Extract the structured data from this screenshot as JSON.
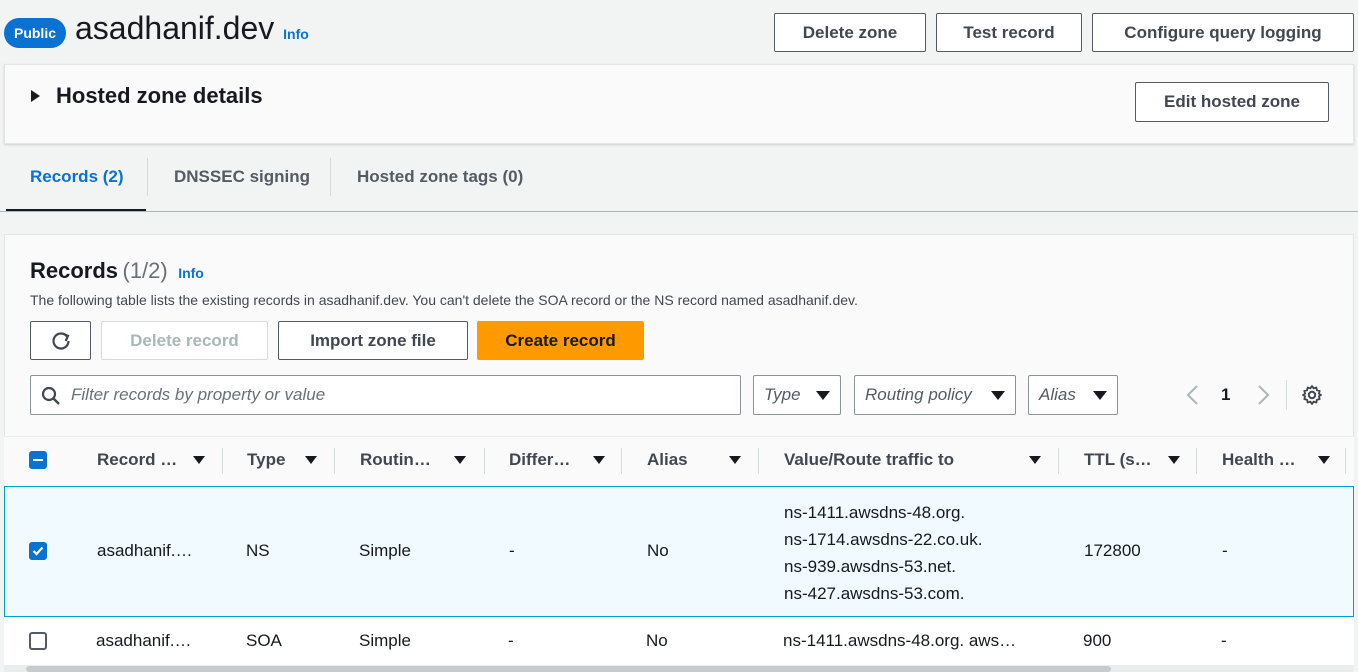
{
  "header": {
    "badge": "Public",
    "zone_name": "asadhanif.dev",
    "info": "Info",
    "buttons": {
      "delete_zone": "Delete zone",
      "test_record": "Test record",
      "configure_logging": "Configure query logging"
    }
  },
  "details_panel": {
    "title": "Hosted zone details",
    "edit_button": "Edit hosted zone"
  },
  "tabs": [
    {
      "label": "Records (2)",
      "active": true
    },
    {
      "label": "DNSSEC signing",
      "active": false
    },
    {
      "label": "Hosted zone tags (0)",
      "active": false
    }
  ],
  "records": {
    "title": "Records",
    "count": "(1/2)",
    "info": "Info",
    "description": "The following table lists the existing records in asadhanif.dev. You can't delete the SOA record or the NS record named asadhanif.dev.",
    "actions": {
      "delete": "Delete record",
      "import": "Import zone file",
      "create": "Create record"
    },
    "filter": {
      "placeholder": "Filter records by property or value",
      "type": "Type",
      "routing_policy": "Routing policy",
      "alias": "Alias"
    },
    "pagination": {
      "page": "1"
    },
    "columns": [
      "Record …",
      "Type",
      "Routin…",
      "Differ…",
      "Alias",
      "Value/Route traffic to",
      "TTL (s…",
      "Health …"
    ],
    "rows": [
      {
        "selected": true,
        "name": "asadhanif.…",
        "type": "NS",
        "routing": "Simple",
        "differentiator": "-",
        "alias": "No",
        "values": [
          "ns-1411.awsdns-48.org.",
          "ns-1714.awsdns-22.co.uk.",
          "ns-939.awsdns-53.net.",
          "ns-427.awsdns-53.com."
        ],
        "ttl": "172800",
        "health": "-"
      },
      {
        "selected": false,
        "name": "asadhanif.…",
        "type": "SOA",
        "routing": "Simple",
        "differentiator": "-",
        "alias": "No",
        "values": [
          "ns-1411.awsdns-48.org. aws…"
        ],
        "ttl": "900",
        "health": "-"
      }
    ]
  },
  "colors": {
    "accent": "#0972d3",
    "primary_button": "#ff9900",
    "selected_row": "#f1faff"
  }
}
